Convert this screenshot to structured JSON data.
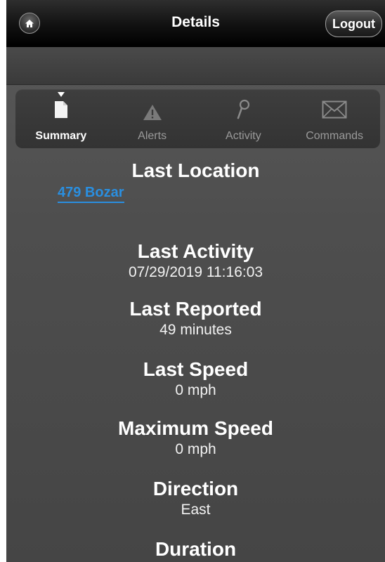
{
  "header": {
    "title": "Details",
    "logout_label": "Logout",
    "home_icon": "home-icon"
  },
  "tabs": [
    {
      "label": "Summary",
      "icon": "document-icon",
      "active": true
    },
    {
      "label": "Alerts",
      "icon": "warning-icon",
      "active": false
    },
    {
      "label": "Activity",
      "icon": "magnifier-icon",
      "active": false
    },
    {
      "label": "Commands",
      "icon": "envelope-icon",
      "active": false
    }
  ],
  "summary": {
    "last_location": {
      "heading": "Last Location",
      "value": "479 Bozar"
    },
    "last_activity": {
      "heading": "Last Activity",
      "value": "07/29/2019 11:16:03"
    },
    "last_reported": {
      "heading": "Last Reported",
      "value": "49 minutes"
    },
    "last_speed": {
      "heading": "Last Speed",
      "value": "0 mph"
    },
    "maximum_speed": {
      "heading": "Maximum Speed",
      "value": "0 mph"
    },
    "direction": {
      "heading": "Direction",
      "value": "East"
    },
    "duration": {
      "heading": "Duration"
    }
  },
  "colors": {
    "link": "#2a8fe0",
    "active_tab_text": "#ffffff",
    "inactive_tab_text": "#9a9a9a"
  }
}
